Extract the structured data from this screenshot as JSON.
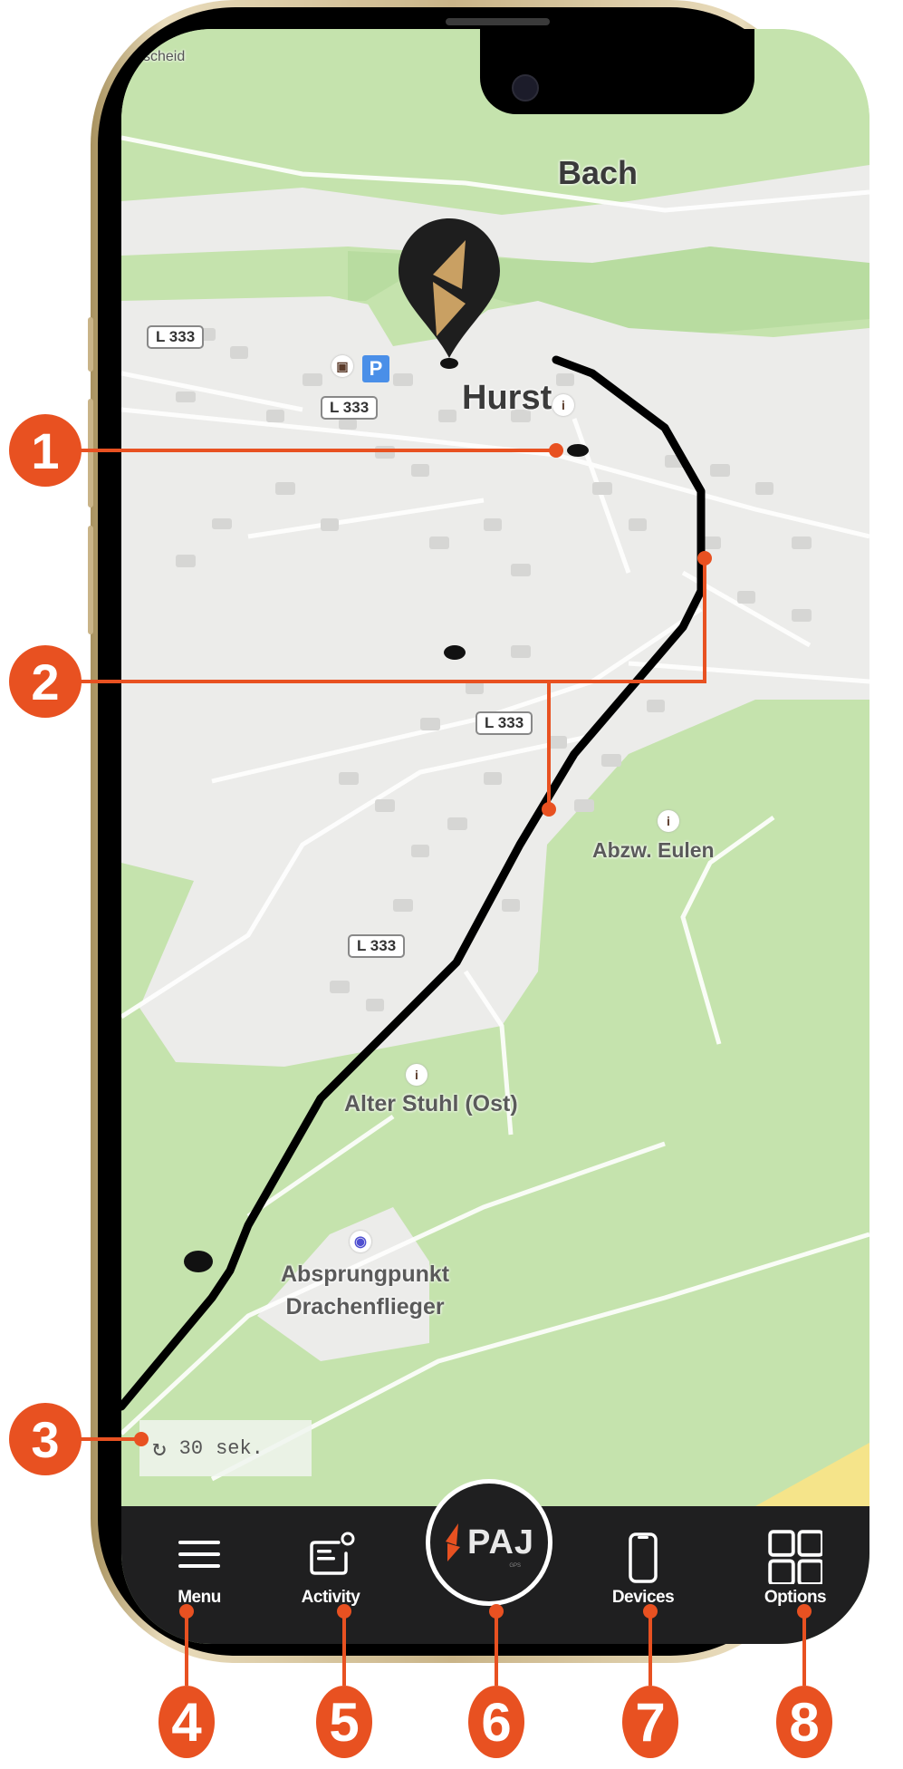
{
  "map": {
    "places": {
      "top_left": "Halscheid",
      "bach": "Bach",
      "hurst": "Hurst",
      "abzw": "Abzw. Eulen",
      "alter_stuhl": "Alter Stuhl (Ost)",
      "absprung_line1": "Absprungpunkt",
      "absprung_line2": "Drachenflieger"
    },
    "road_shields": [
      "L 333",
      "L 333",
      "L 333",
      "L 333"
    ],
    "parking_glyph": "P",
    "info_glyph": "i",
    "colors": {
      "forest": "#c5e3ad",
      "forest_dark": "#b8dca0",
      "urban": "#ececea",
      "building": "#d8d8d6",
      "track": "#000000",
      "pin_body": "#1e1e1e",
      "pin_logo": "#c9a063"
    }
  },
  "refresh": {
    "interval_value": "30",
    "interval_unit": "sek."
  },
  "navbar": {
    "items": [
      {
        "label": "Menu",
        "icon": "hamburger-icon"
      },
      {
        "label": "Activity",
        "icon": "activity-icon"
      },
      {
        "label": "PAJ",
        "icon": "paj-logo"
      },
      {
        "label": "Devices",
        "icon": "smartphone-icon"
      },
      {
        "label": "Options",
        "icon": "grid-icon"
      }
    ],
    "paj_subtext": "GPS",
    "colors": {
      "background": "#1f1f20",
      "foreground": "#ffffff",
      "logo_accent": "#e85121"
    }
  },
  "annotations": {
    "color": "#e85121",
    "badges": [
      "1",
      "2",
      "3",
      "4",
      "5",
      "6",
      "7",
      "8"
    ]
  }
}
